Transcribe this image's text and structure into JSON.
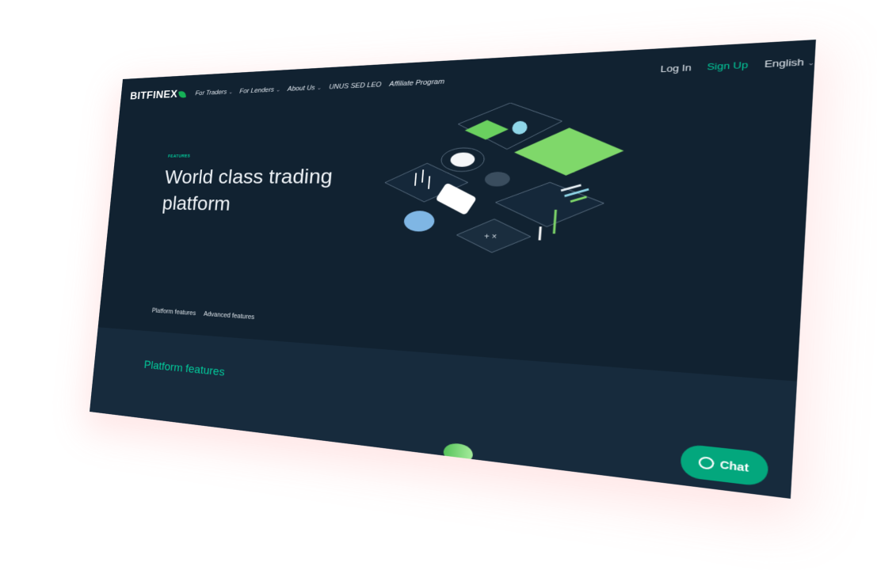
{
  "brand": {
    "logo_text": "BITFINEX"
  },
  "nav": {
    "items": [
      {
        "label": "For Traders",
        "has_dropdown": true
      },
      {
        "label": "For Lenders",
        "has_dropdown": true
      },
      {
        "label": "About Us",
        "has_dropdown": true
      },
      {
        "label": "UNUS SED LEO",
        "has_dropdown": false
      },
      {
        "label": "Affiliate Program",
        "has_dropdown": false
      }
    ],
    "login": "Log In",
    "signup": "Sign Up",
    "language": "English"
  },
  "hero": {
    "eyebrow": "FEATURES",
    "title": "World class trading platform",
    "tabs": [
      "Platform features",
      "Advanced features"
    ],
    "illustration": "isometric-trading-icons"
  },
  "section": {
    "title": "Platform features"
  },
  "chat": {
    "label": "Chat",
    "icon": "chat-bubble-icon"
  },
  "colors": {
    "accent": "#03ca9b",
    "hero_bg": "#112231",
    "section_bg": "#172b3d",
    "chat_bg": "#03a77d"
  }
}
